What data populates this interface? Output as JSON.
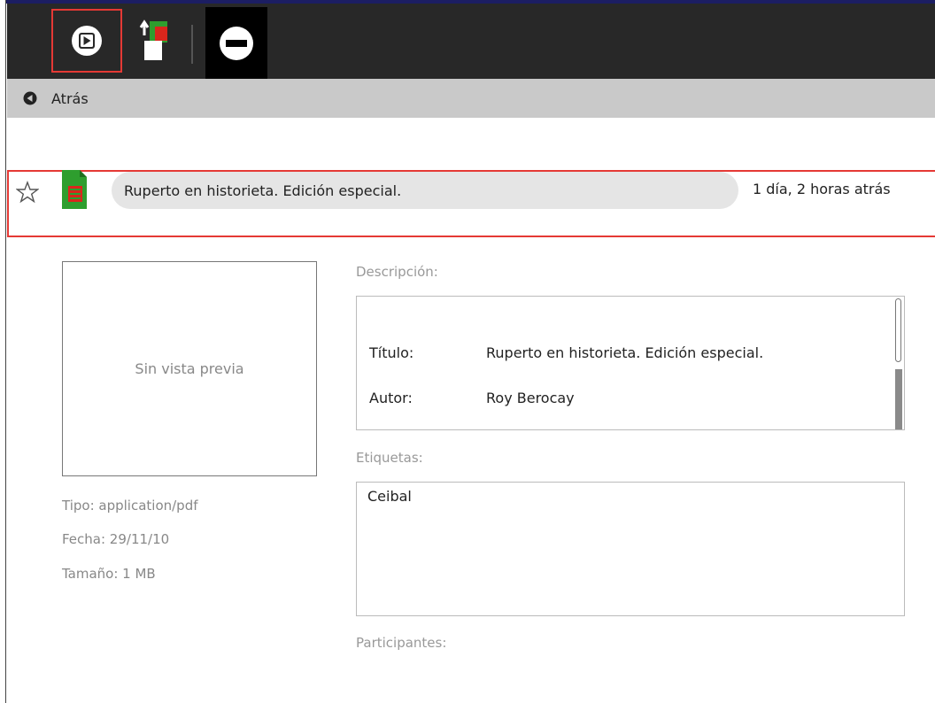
{
  "toolbar": {
    "resume_icon": "play-circle-icon",
    "copy_icon": "copy-to-icon",
    "erase_icon": "minus-circle-icon"
  },
  "back": {
    "label": "Atrás",
    "icon": "back-arrow-icon"
  },
  "entry": {
    "title": "Ruperto en historieta. Edición especial.",
    "date": "1 día, 2 horas atrás",
    "favorite_icon": "star-outline-icon",
    "type_icon": "pdf-document-icon"
  },
  "preview": {
    "text": "Sin vista previa"
  },
  "metadata": {
    "type": "Tipo: application/pdf",
    "date": "Fecha: 29/11/10",
    "size": "Tamaño: 1 MB"
  },
  "description": {
    "label": "Descripción:",
    "rows": [
      {
        "key": "Título:",
        "value": "Ruperto en historieta. Edición especial."
      },
      {
        "key": "Autor:",
        "value": "Roy Berocay"
      }
    ]
  },
  "tags": {
    "label": "Etiquetas:",
    "value": "Ceibal"
  },
  "participants": {
    "label": "Participantes:"
  },
  "colors": {
    "toolbar": "#282828",
    "backbar": "#c9c9c9",
    "highlight": "#e53935",
    "doc_green": "#2e9e2e",
    "doc_red": "#d9261c"
  }
}
